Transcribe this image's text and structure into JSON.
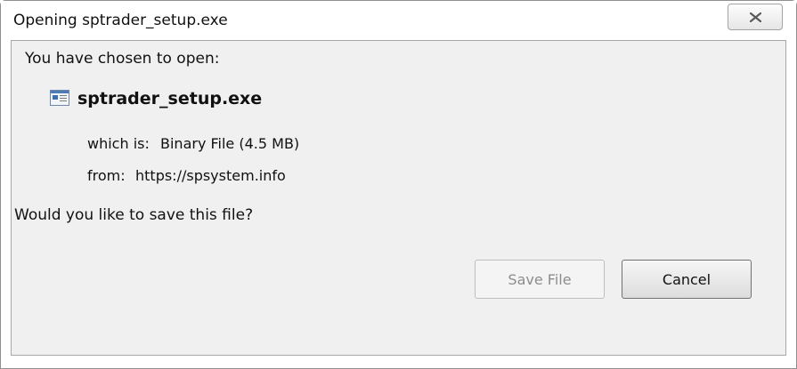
{
  "window": {
    "title": "Opening sptrader_setup.exe",
    "close_icon": "close-x-icon"
  },
  "dialog": {
    "prompt": "You have chosen to open:",
    "file_icon": "executable-file-icon",
    "filename": "sptrader_setup.exe",
    "which_is_label": "which is:",
    "which_is_value": "Binary File (4.5 MB)",
    "from_label": "from:",
    "from_value": "https://spsystem.info",
    "question": "Would you like to save this file?"
  },
  "buttons": {
    "save_label": "Save File",
    "cancel_label": "Cancel"
  }
}
